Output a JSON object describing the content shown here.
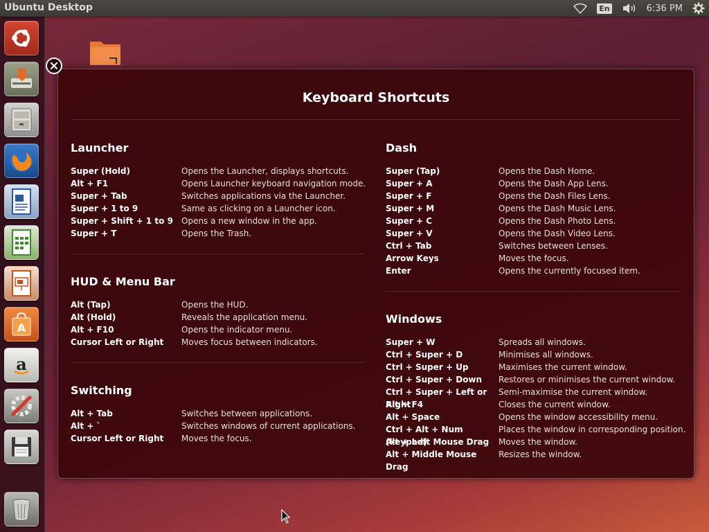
{
  "panel": {
    "title": "Ubuntu Desktop",
    "lang": "En",
    "clock": "6:36 PM"
  },
  "overlay": {
    "title": "Keyboard Shortcuts",
    "sections_left": [
      {
        "title": "Launcher",
        "rows": [
          {
            "key": "Super (Hold)",
            "desc": "Opens the Launcher, displays shortcuts."
          },
          {
            "key": "Alt + F1",
            "desc": "Opens Launcher keyboard navigation mode."
          },
          {
            "key": "Super + Tab",
            "desc": "Switches applications via the Launcher."
          },
          {
            "key": "Super + 1 to 9",
            "desc": "Same as clicking on a Launcher icon."
          },
          {
            "key": "Super + Shift + 1 to 9",
            "desc": "Opens a new window in the app."
          },
          {
            "key": "Super + T",
            "desc": "Opens the Trash."
          }
        ]
      },
      {
        "title": "HUD & Menu Bar",
        "rows": [
          {
            "key": "Alt (Tap)",
            "desc": "Opens the HUD."
          },
          {
            "key": "Alt (Hold)",
            "desc": "Reveals the application menu."
          },
          {
            "key": "Alt + F10",
            "desc": "Opens the indicator menu."
          },
          {
            "key": "Cursor Left or Right",
            "desc": "Moves focus between indicators."
          }
        ]
      },
      {
        "title": "Switching",
        "rows": [
          {
            "key": "Alt + Tab",
            "desc": "Switches between applications."
          },
          {
            "key": "Alt + `",
            "desc": "Switches windows of current applications."
          },
          {
            "key": "Cursor Left or Right",
            "desc": "Moves the focus."
          }
        ]
      }
    ],
    "sections_right": [
      {
        "title": "Dash",
        "rows": [
          {
            "key": "Super (Tap)",
            "desc": "Opens the Dash Home."
          },
          {
            "key": "Super + A",
            "desc": "Opens the Dash App Lens."
          },
          {
            "key": "Super + F",
            "desc": "Opens the Dash Files Lens."
          },
          {
            "key": "Super + M",
            "desc": "Opens the Dash Music Lens."
          },
          {
            "key": "Super + C",
            "desc": "Opens the Dash Photo Lens."
          },
          {
            "key": "Super + V",
            "desc": "Opens the Dash Video Lens."
          },
          {
            "key": "Ctrl + Tab",
            "desc": "Switches between Lenses."
          },
          {
            "key": "Arrow Keys",
            "desc": "Moves the focus."
          },
          {
            "key": "Enter",
            "desc": "Opens the currently focused item."
          }
        ]
      },
      {
        "title": "Windows",
        "rows": [
          {
            "key": "Super + W",
            "desc": "Spreads all windows."
          },
          {
            "key": "Ctrl + Super + D",
            "desc": "Minimises all windows."
          },
          {
            "key": "Ctrl + Super + Up",
            "desc": "Maximises the current window."
          },
          {
            "key": "Ctrl + Super + Down",
            "desc": "Restores or minimises the current window."
          },
          {
            "key": "Ctrl + Super + Left or Right",
            "desc": "Semi-maximise the current window."
          },
          {
            "key": "Alt + F4",
            "desc": "Closes the current window."
          },
          {
            "key": "Alt + Space",
            "desc": "Opens the window accessibility menu."
          },
          {
            "key": "Ctrl + Alt + Num (keypad)",
            "desc": "Places the window in corresponding position."
          },
          {
            "key": "Alt + Left Mouse Drag",
            "desc": "Moves the window."
          },
          {
            "key": "Alt + Middle Mouse Drag",
            "desc": "Resizes the window."
          }
        ]
      }
    ]
  }
}
